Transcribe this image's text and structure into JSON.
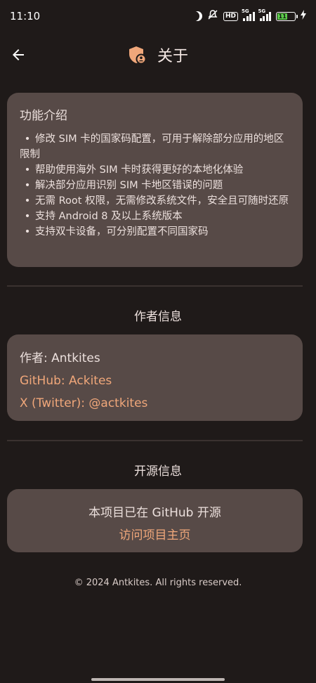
{
  "status_bar": {
    "time": "11:10",
    "hd_label": "HD",
    "sim1_label": "5G",
    "sim2_label": "5G",
    "battery_level": "11",
    "icons": [
      "moon-icon",
      "mute-icon",
      "hd-icon",
      "signal-icon",
      "signal-icon",
      "battery-icon",
      "charging-icon"
    ]
  },
  "header": {
    "title": "关于",
    "back_icon": "arrow-left-icon",
    "app_icon": "shield-icon"
  },
  "features": {
    "title": "功能介绍",
    "items": [
      "修改 SIM 卡的国家码配置，可用于解除部分应用的地区限制",
      "帮助使用海外 SIM 卡时获得更好的本地化体验",
      "解决部分应用识别 SIM 卡地区错误的问题",
      "无需 Root 权限，无需修改系统文件，安全且可随时还原",
      "支持 Android 8 及以上系统版本",
      "支持双卡设备，可分别配置不同国家码"
    ]
  },
  "author_section": {
    "heading": "作者信息",
    "author": "作者: Antkites",
    "github": "GitHub: Ackites",
    "twitter": "X (Twitter): @actkites"
  },
  "opensource_section": {
    "heading": "开源信息",
    "text": "本项目已在 GitHub 开源",
    "link": "访问项目主页"
  },
  "footer": {
    "copyright": "© 2024 Antkites. All rights reserved."
  },
  "colors": {
    "background": "#1f1a19",
    "card": "#574a47",
    "accent": "#f0a77a",
    "text": "#ece0dd"
  }
}
